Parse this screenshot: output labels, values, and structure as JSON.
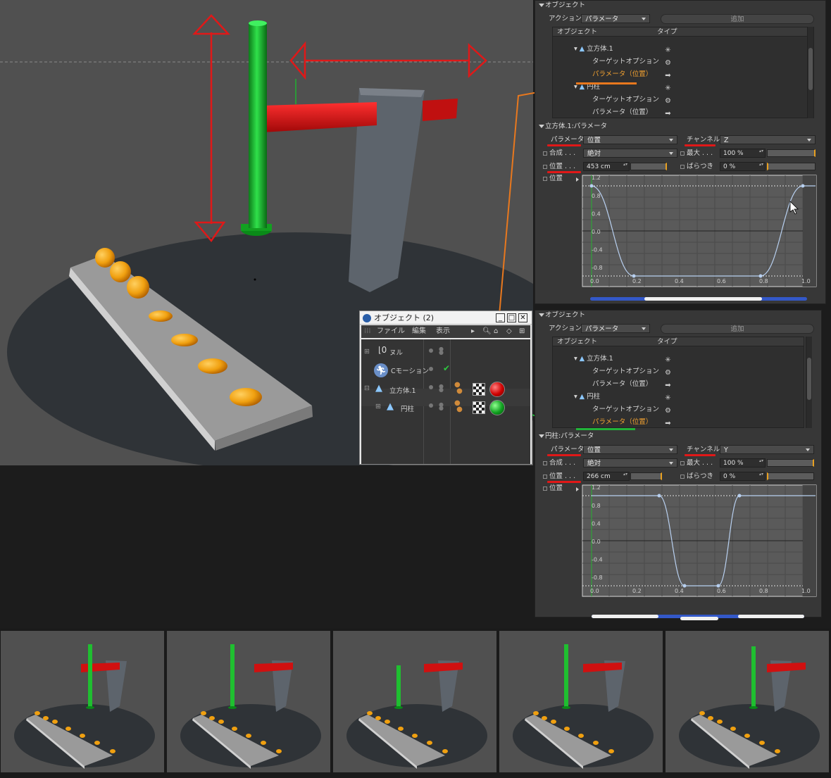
{
  "panel_top": {
    "title": "オブジェクト",
    "action_label": "アクション",
    "action_value": "パラメータ",
    "add_label": "追加",
    "col_object": "オブジェクト",
    "col_type": "タイプ",
    "rows": [
      "立方体.1",
      "ターゲットオプション",
      "パラメータ（位置）",
      "円柱",
      "ターゲットオプション",
      "パラメータ（位置）"
    ],
    "param_title": "立方体.1:パラメータ",
    "param_label": "パラメータ",
    "param_value": "位置",
    "channel_label": "チャンネル",
    "channel_value": "Z",
    "blend_label": "合成 . . .",
    "blend_value": "絶対",
    "max_label": "最大 . . .",
    "max_value": "100 %",
    "pos_label": "位置 . . .",
    "pos_value": "453 cm",
    "var_label": "ばらつき",
    "var_value": "0 %",
    "curve_label": "位置"
  },
  "panel_bottom": {
    "title": "オブジェクト",
    "action_label": "アクション",
    "action_value": "パラメータ",
    "add_label": "追加",
    "col_object": "オブジェクト",
    "col_type": "タイプ",
    "rows": [
      "立方体.1",
      "ターゲットオプション",
      "パラメータ（位置）",
      "円柱",
      "ターゲットオプション",
      "パラメータ（位置）"
    ],
    "param_title": "円柱:パラメータ",
    "param_label": "パラメータ",
    "param_value": "位置",
    "channel_label": "チャンネル",
    "channel_value": "Y",
    "blend_label": "合成 . . .",
    "blend_value": "絶対",
    "max_label": "最大 . . .",
    "max_value": "100 %",
    "pos_label": "位置 . . .",
    "pos_value": "266 cm",
    "var_label": "ばらつき",
    "var_value": "0 %",
    "curve_label": "位置"
  },
  "curve_axes": {
    "y_ticks": [
      "1.2",
      "0.8",
      "0.4",
      "0.0",
      "-0.4",
      "-0.8"
    ],
    "x_ticks": [
      "0.0",
      "0.2",
      "0.4",
      "0.6",
      "0.8",
      "1.0"
    ]
  },
  "curve_top_points": [
    [
      0.0,
      1.0
    ],
    [
      0.2,
      -1.0
    ],
    [
      0.8,
      -1.0
    ],
    [
      1.0,
      1.0
    ]
  ],
  "curve_bottom_points": [
    [
      0.32,
      1.0
    ],
    [
      0.44,
      -1.0
    ],
    [
      0.6,
      -1.0
    ],
    [
      0.7,
      1.0
    ]
  ],
  "object_manager": {
    "title": "オブジェクト (2)",
    "menu": [
      "ファイル",
      "編集",
      "表示"
    ],
    "items": [
      "ヌル",
      "Cモーション",
      "立方体.1",
      "円柱"
    ]
  },
  "colors": {
    "accent_orange": "#e8781e",
    "annotation_red": "#e01818",
    "annotation_green": "#22b33a",
    "highlight_text": "#f0a030"
  }
}
